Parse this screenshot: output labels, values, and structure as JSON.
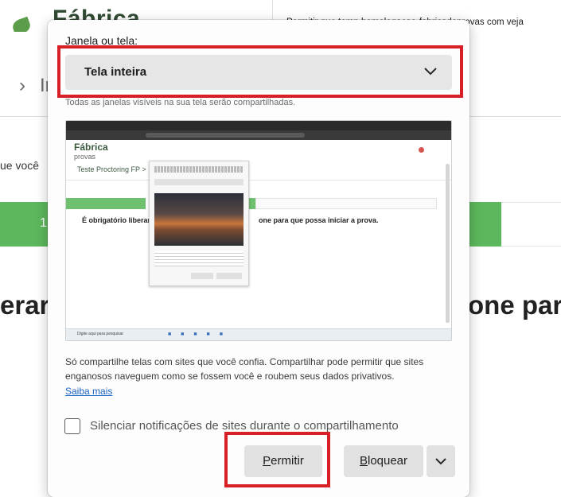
{
  "background": {
    "brand_name": "Fábrica",
    "permission_prompt_text": "Permitir que temp homologacao-fabricadeprovas com veja",
    "breadcrumb_text": "In",
    "instruction_fragment": "ue você",
    "progress_number": "1",
    "heading_left": "erar",
    "heading_right": "one par"
  },
  "dialog": {
    "source_label_prefix": "J",
    "source_label_rest": "anela ou tela:",
    "select_value": "Tela inteira",
    "select_hint": "Todas as janelas visíveis na sua tela serão compartilhadas.",
    "preview": {
      "brand": "Fábrica",
      "brand_sub": "provas",
      "breadcrumb": "Teste Proctoring FP > ...",
      "heading_left": "É obrigatório liberar",
      "heading_right": "one para que possa iniciar a prova.",
      "taskbar_search": "Digite aqui para pesquisar"
    },
    "warning_text": "Só compartilhe telas com sites que você confia. Compartilhar pode permitir que sites enganosos naveguem como se fossem você e roubem seus dados privativos.",
    "learn_more": "Saiba mais",
    "mute_checkbox_label": "Silenciar notificações de sites durante o compartilhamento",
    "mute_checked": false,
    "permit_label_prefix": "P",
    "permit_label_rest": "ermitir",
    "block_label_prefix": "B",
    "block_label_rest": "loquear"
  },
  "icons": {
    "select_chevron": "chevron-down-icon",
    "block_menu_chevron": "chevron-down-icon",
    "brand_leaf": "leaf-icon"
  },
  "colors": {
    "highlight": "#d91f26",
    "progress_green": "#5cb85c",
    "link": "#1a62c4"
  }
}
